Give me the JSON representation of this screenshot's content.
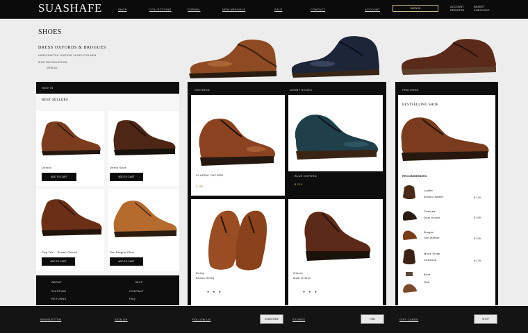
{
  "header": {
    "logo": "SUASHAFE",
    "nav": [
      "SHOP",
      "COLLECTIONS",
      "FORMAL",
      "NEW ARRIVALS",
      "SALE",
      "CONTACT",
      "ACCOUNT"
    ],
    "nav_button": "SIGN IN",
    "account": [
      "ACCOUNT",
      "REGISTER"
    ],
    "cart": [
      "BASKET",
      "CHECKOUT"
    ]
  },
  "hero": {
    "title": "SHOES",
    "subtitle": "DRESS OXFORDS & BROGUES",
    "line1": "HANDCRAFTED LEATHER SHOES FOR MEN",
    "line2": "SHOP THE COLLECTION",
    "line3": "VIEW ALL"
  },
  "left_panel": {
    "header": "NEW IN",
    "title": "BEST SELLERS",
    "items": [
      {
        "name": "Oxford",
        "button": "ADD TO CART"
      },
      {
        "name": "Derby Shoe",
        "button": "ADD TO CART"
      },
      {
        "name": "Cap Toe",
        "price": "Brown Oxford",
        "button": "ADD TO CART"
      },
      {
        "name": "Tan Brogue Shoe",
        "button": "ADD TO CART"
      }
    ],
    "footer_left": [
      "ABOUT",
      "SHIPPING",
      "RETURNS"
    ],
    "footer_right": [
      "HELP",
      "CONTACT",
      "FAQ"
    ]
  },
  "center_panel": {
    "tabs": [
      "OXFORDS",
      "DERBY SHOES"
    ],
    "card_labels": [
      "CLASSIC OXFORD",
      "BLUE OXFORD",
      "$ 189",
      "$ 219"
    ],
    "bottom_labels": [
      "Derby",
      "Brown Derby",
      "Oxford",
      "Dark Oxford"
    ]
  },
  "right_panel": {
    "header": "FEATURED",
    "title": "BESTSELLING SHOE",
    "list_title": "RECOMMENDED",
    "items": [
      {
        "name": "Loafer",
        "sub": "Brown leather",
        "price": "$ 149"
      },
      {
        "name": "Chelsea",
        "sub": "Dark brown",
        "price": "$ 169"
      },
      {
        "name": "Brogue",
        "sub": "Tan leather",
        "price": "$ 159"
      },
      {
        "name": "Monk Strap",
        "sub": "Chestnut",
        "price": "$ 179"
      },
      {
        "name": "Boot",
        "sub": "Oak",
        "price": ""
      }
    ]
  },
  "footer": {
    "labels": [
      "NEWSLETTER",
      "SIGN UP",
      "FOLLOW US",
      "STORES",
      "GIFT CARDS"
    ],
    "buttons": [
      "SUBSCRIBE",
      "FIND",
      "SHOP"
    ]
  },
  "colors": {
    "brown": "#6e3a20",
    "tan": "#a9612c",
    "navy": "#1b2336",
    "teal": "#264f5a",
    "black": "#0b0b0b",
    "sole": "#1e1a17"
  }
}
